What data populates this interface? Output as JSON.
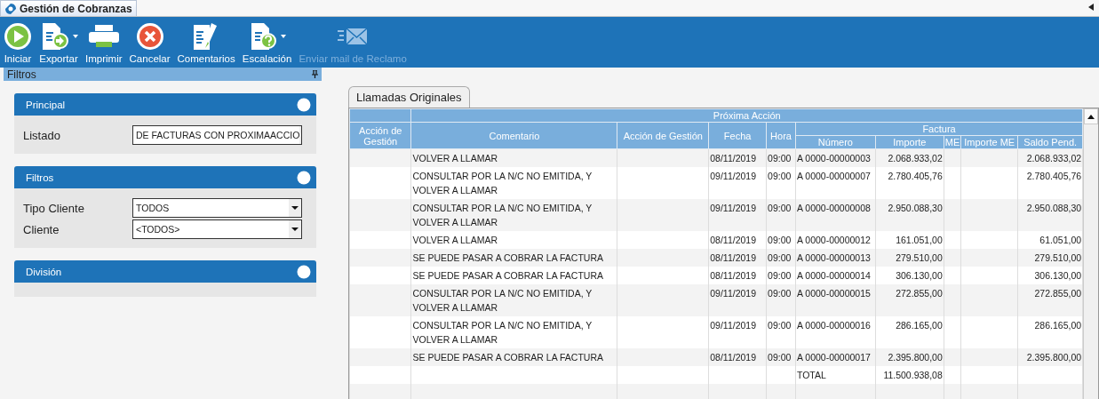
{
  "window": {
    "tab": {
      "title": "Gestión de Cobranzas",
      "selected": true
    }
  },
  "toolbar": [
    {
      "kind": "play",
      "label": "Iniciar",
      "disabled": false,
      "dropdown": false
    },
    {
      "kind": "export",
      "label": "Exportar",
      "disabled": false,
      "dropdown": true
    },
    {
      "kind": "print",
      "label": "Imprimir",
      "disabled": false,
      "dropdown": false
    },
    {
      "kind": "cancel",
      "label": "Cancelar",
      "disabled": false,
      "dropdown": false
    },
    {
      "kind": "comment",
      "label": "Comentarios",
      "disabled": false,
      "dropdown": false
    },
    {
      "kind": "escalate",
      "label": "Escalación",
      "disabled": false,
      "dropdown": true
    },
    {
      "kind": "mail",
      "label": "Enviar mail de Reclamo",
      "disabled": true,
      "dropdown": false
    }
  ],
  "filters_panel": {
    "title": "Filtros",
    "sections": [
      {
        "title": "Principal",
        "fields": [
          {
            "label": "Listado",
            "value": "DE FACTURAS CON PROXIMAACCIO"
          }
        ]
      },
      {
        "title": "Filtros",
        "fields": [
          {
            "label": "Tipo Cliente",
            "value": "TODOS"
          },
          {
            "label": "Cliente",
            "value": "<TODOS>"
          }
        ]
      },
      {
        "title": "División"
      }
    ]
  },
  "tabs": [
    {
      "label": "Llamadas Originales",
      "selected": true
    }
  ],
  "table": {
    "group_header": "Próxima Acción",
    "subgroup_header": "Factura",
    "columns": [
      "Acción de Gestión",
      "Comentario",
      "Acción de Gestión",
      "Fecha",
      "Hora",
      "Número",
      "Importe",
      "ME",
      "Importe ME",
      "Saldo Pend."
    ],
    "rows": [
      [
        "",
        "VOLVER A LLAMAR",
        "",
        "08/11/2019",
        "09:00",
        "A 0000-00000003",
        "2.068.933,02",
        "",
        "",
        "2.068.933,02"
      ],
      [
        "",
        "CONSULTAR POR LA N/C NO EMITIDA, Y VOLVER A LLAMAR",
        "",
        "09/11/2019",
        "09:00",
        "A 0000-00000007",
        "2.780.405,76",
        "",
        "",
        "2.780.405,76"
      ],
      [
        "",
        "CONSULTAR POR LA N/C NO EMITIDA, Y VOLVER A LLAMAR",
        "",
        "09/11/2019",
        "09:00",
        "A 0000-00000008",
        "2.950.088,30",
        "",
        "",
        "2.950.088,30"
      ],
      [
        "",
        "VOLVER A LLAMAR",
        "",
        "08/11/2019",
        "09:00",
        "A 0000-00000012",
        "161.051,00",
        "",
        "",
        "61.051,00"
      ],
      [
        "",
        "SE PUEDE PASAR A COBRAR LA FACTURA",
        "",
        "08/11/2019",
        "09:00",
        "A 0000-00000013",
        "279.510,00",
        "",
        "",
        "279.510,00"
      ],
      [
        "",
        "SE PUEDE PASAR A COBRAR LA FACTURA",
        "",
        "08/11/2019",
        "09:00",
        "A 0000-00000014",
        "306.130,00",
        "",
        "",
        "306.130,00"
      ],
      [
        "",
        "CONSULTAR POR LA N/C NO EMITIDA, Y VOLVER A LLAMAR",
        "",
        "09/11/2019",
        "09:00",
        "A 0000-00000015",
        "272.855,00",
        "",
        "",
        "272.855,00"
      ],
      [
        "",
        "CONSULTAR POR LA N/C NO EMITIDA, Y VOLVER A LLAMAR",
        "",
        "09/11/2019",
        "09:00",
        "A 0000-00000016",
        "286.165,00",
        "",
        "",
        "286.165,00"
      ],
      [
        "",
        "SE PUEDE PASAR A COBRAR LA FACTURA",
        "",
        "08/11/2019",
        "09:00",
        "A 0000-00000017",
        "2.395.800,00",
        "",
        "",
        "2.395.800,00"
      ]
    ],
    "total": {
      "label": "TOTAL",
      "importe": "11.500.938,08"
    }
  }
}
